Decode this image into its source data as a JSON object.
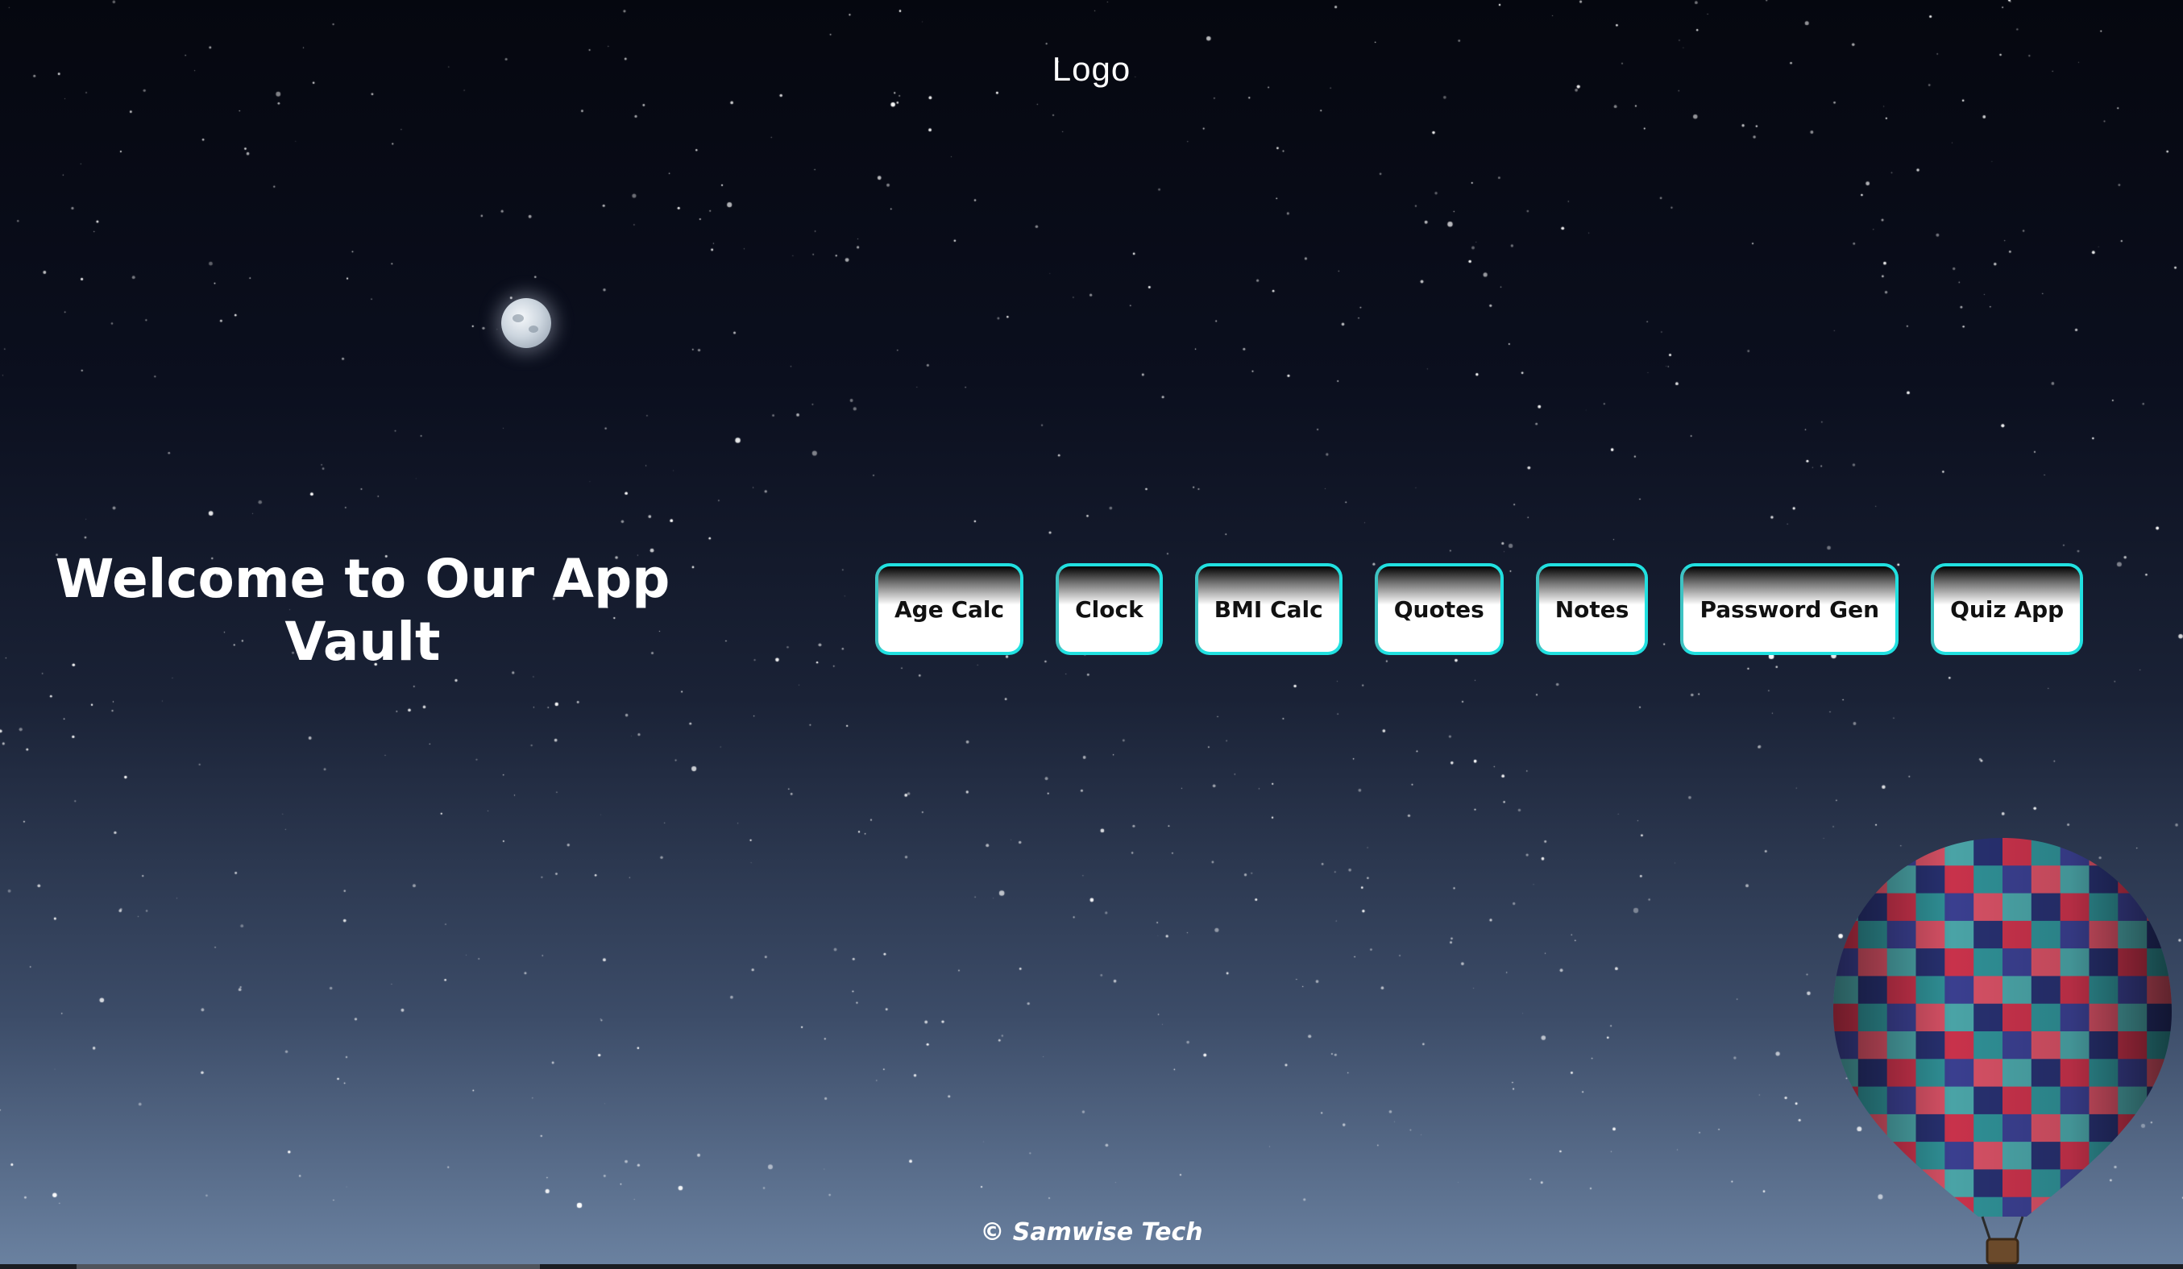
{
  "header": {
    "logo_text": "Logo"
  },
  "hero": {
    "title_line1": "Welcome to Our App",
    "title_line2": "Vault"
  },
  "apps": [
    {
      "label": "Age Calc"
    },
    {
      "label": "Clock"
    },
    {
      "label": "BMI Calc"
    },
    {
      "label": "Quotes"
    },
    {
      "label": "Notes"
    },
    {
      "label": "Password Gen"
    },
    {
      "label": "Quiz App"
    }
  ],
  "footer": {
    "copyright": "© Samwise Tech"
  },
  "colors": {
    "button_border": "#21e0e0",
    "text_light": "#ffffff",
    "text_dark": "#111111"
  },
  "icons": {
    "moon": "moon-icon",
    "balloon": "hot-air-balloon-icon"
  }
}
